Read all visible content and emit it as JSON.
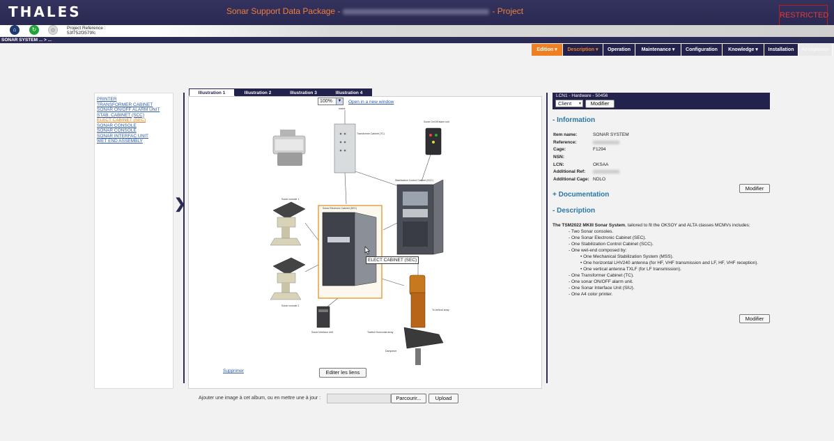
{
  "header": {
    "logo": "THALES",
    "title_prefix": "Sonar Support Data Package -",
    "title_suffix": "- Project",
    "restricted": "RESTRICTED"
  },
  "subheader": {
    "project_reference_label": "Project Reference :",
    "project_reference_value": "53f752f3579fc"
  },
  "breadcrumb": "SONAR SYSTEM ... > ...",
  "nav": [
    {
      "label": "Edition",
      "dropdown": true
    },
    {
      "label": "Description",
      "dropdown": true
    },
    {
      "label": "Operation",
      "dropdown": false
    },
    {
      "label": "Maintenance",
      "dropdown": true
    },
    {
      "label": "Configuration",
      "dropdown": false
    },
    {
      "label": "Knowledge",
      "dropdown": true
    },
    {
      "label": "Installation",
      "dropdown": false
    },
    {
      "label": "Acceptance",
      "dropdown": false
    }
  ],
  "left_list": [
    "PRINTER",
    "TRANSFORMER CABINET",
    "SONAR ON/OFF ALARM UNIT",
    "STAB. CABINET (SCC)",
    "ELECT CABINET (SEC)",
    "SONAR CONSOLE",
    "SONAR CONSOLE",
    "SONAR INTERFAC UNIT",
    "WET END ASSEMBLY"
  ],
  "tabs": [
    "Illustration 1",
    "Illustration 2",
    "Illustration 3",
    "Illustration 4"
  ],
  "viewer": {
    "zoom": "100%",
    "open_link": "Open in a new window",
    "tooltip": "ELECT CABINET (SEC)",
    "supprimer": "Supprimer",
    "edit_links": "Editer les liens"
  },
  "diagram_labels": {
    "transformer": "Transformer Cabinet (TC)",
    "onoff": "Sonar On/Off alarm unit",
    "scc": "Stabilization Control Cabinet (SCC)",
    "sec": "Sonar Electronic Cabinet (SEC)",
    "console1": "Sonar console 1",
    "console2": "Sonar console 2",
    "siu": "Sonar Interface Unit",
    "towfish": "Towfish Horizontal array",
    "vertical": "To vertical array",
    "damper": "Dampener",
    "mains": "mains"
  },
  "upload": {
    "text": "Ajouter une image à cet album, ou en mettre une à jour :",
    "browse": "Parcourir...",
    "button": "Upload"
  },
  "right": {
    "header": "LCN1 - Hardware - 50456",
    "client_select": "Client",
    "modify": "Modifier",
    "information_title": "- Information",
    "info": [
      {
        "label": "Item name:",
        "value": "SONAR SYSTEM",
        "blur": false
      },
      {
        "label": "Reference:",
        "value": "",
        "blur": true
      },
      {
        "label": "Cage:",
        "value": "F1294",
        "blur": false
      },
      {
        "label": "NSN:",
        "value": "",
        "blur": false
      },
      {
        "label": "LCN:",
        "value": "OKSAA",
        "blur": false
      },
      {
        "label": "Additional Ref:",
        "value": "",
        "blur": true
      },
      {
        "label": "Additional Cage:",
        "value": "NDLO",
        "blur": false
      }
    ],
    "documentation_title": "+ Documentation",
    "description_title": "- Description",
    "description_intro_bold": "The TSM2022 MKIII Sonar System",
    "description_intro_rest": ", tailored to fit the OKSOY and ALTA classes MCMVs includes:",
    "description_items": [
      "- Two Sonar consoles.",
      "- One Sonar Electronic Cabinet (SEC).",
      "- One Stabilization Control Cabinet (SCC).",
      "- One wet-end composed by:",
      "- One Transformer Cabinet (TC).",
      "- One sonar ON/OFF alarm unit.",
      "- One Sonar Interface Unit (SIU).",
      "- One A4 color printer."
    ],
    "wetend_items": [
      "• One Mechanical Stabilization System (MSS).",
      "• One horizontal LHV240 antenna (for HF, VHF transmission and LF, HF, VHF reception).",
      "• One vertical antenna TXLF (for LF transmission)."
    ]
  }
}
